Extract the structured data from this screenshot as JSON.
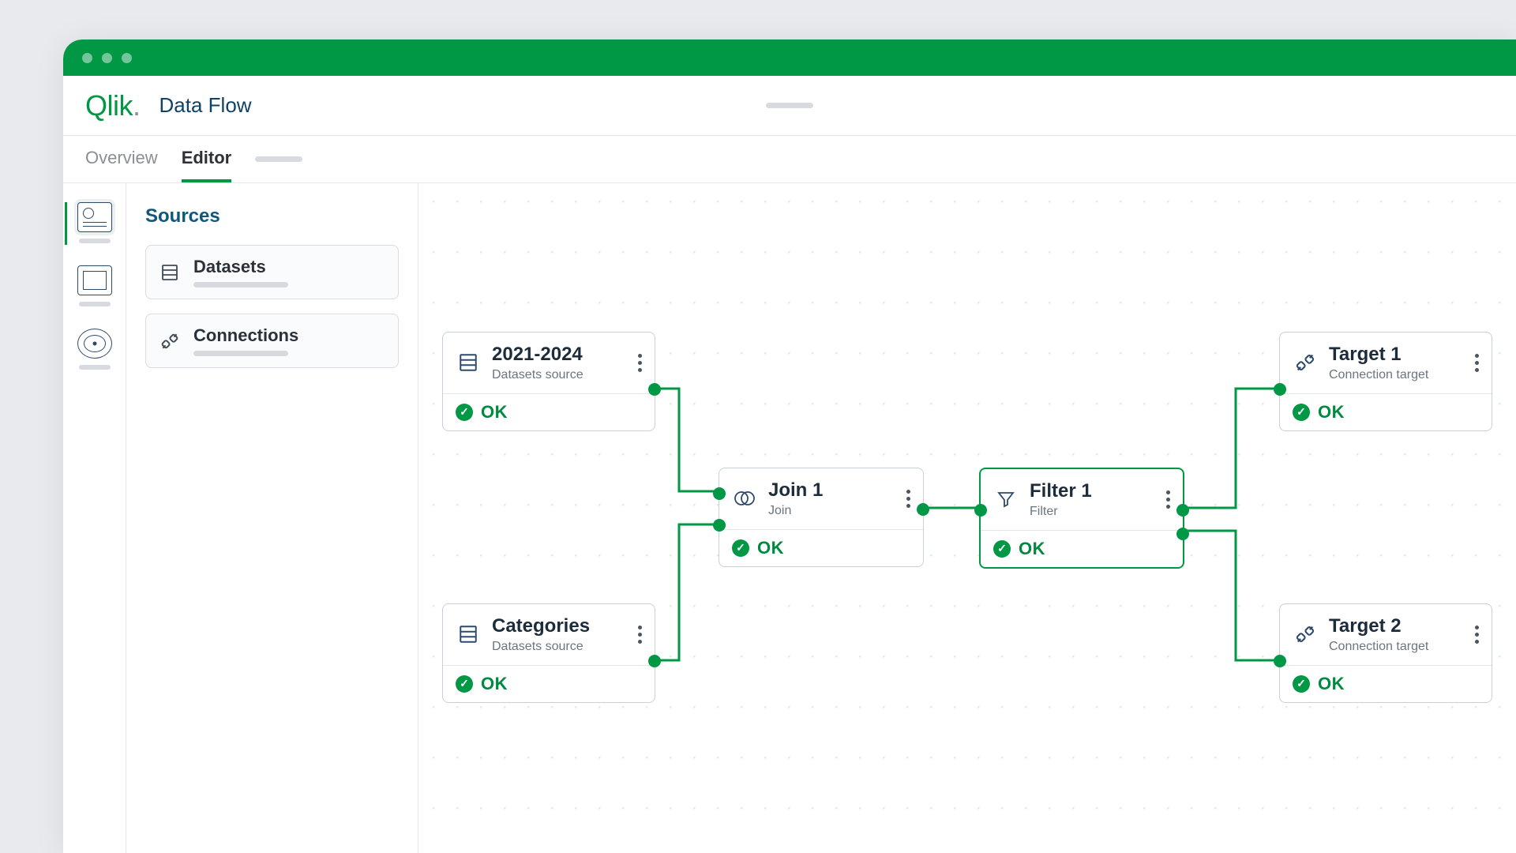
{
  "brand": "Qlik",
  "app_title": "Data Flow",
  "tabs": {
    "overview": "Overview",
    "editor": "Editor"
  },
  "side_panel": {
    "title": "Sources",
    "items": [
      {
        "label": "Datasets"
      },
      {
        "label": "Connections"
      }
    ]
  },
  "rail": {
    "items": [
      "diagram",
      "component",
      "target"
    ]
  },
  "status_label": "OK",
  "nodes": {
    "src1": {
      "title": "2021-2024",
      "subtitle": "Datasets source",
      "status": "OK"
    },
    "src2": {
      "title": "Categories",
      "subtitle": "Datasets source",
      "status": "OK"
    },
    "join": {
      "title": "Join 1",
      "subtitle": "Join",
      "status": "OK"
    },
    "filter": {
      "title": "Filter 1",
      "subtitle": "Filter",
      "status": "OK"
    },
    "tgt1": {
      "title": "Target 1",
      "subtitle": "Connection target",
      "status": "OK"
    },
    "tgt2": {
      "title": "Target 2",
      "subtitle": "Connection target",
      "status": "OK"
    }
  },
  "colors": {
    "accent": "#009845",
    "brand": "#10577d"
  }
}
